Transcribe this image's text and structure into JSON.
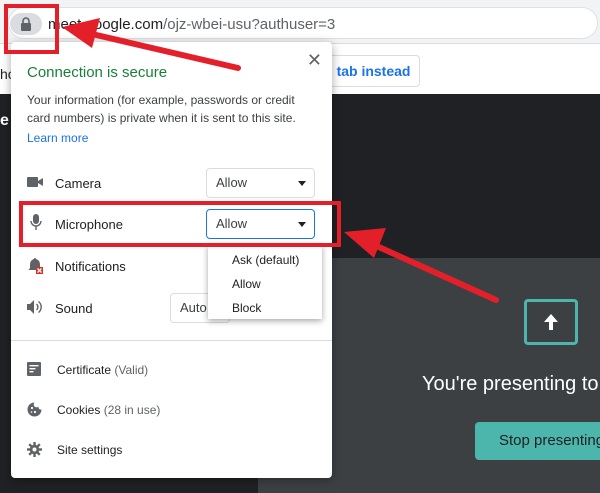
{
  "browser": {
    "url_host": "meet.google.com",
    "url_path": "/ojz-wbei-usu?authuser=3",
    "lock_icon": "lock-icon"
  },
  "page": {
    "left_edge_text": "ho",
    "left_dark_text": "e",
    "tab_button_label": "is tab instead",
    "present_icon": "present-screen-icon",
    "presenting_text": "You're presenting to",
    "stop_button_label": "Stop presenting"
  },
  "popup": {
    "close_label": "✕",
    "title": "Connection is secure",
    "description": "Your information (for example, passwords or credit card numbers) is private when it is sent to this site.",
    "learn_more": "Learn more",
    "permissions": [
      {
        "label": "Camera",
        "value": "Allow",
        "icon": "camera-icon"
      },
      {
        "label": "Microphone",
        "value": "Allow",
        "icon": "microphone-icon"
      },
      {
        "label": "Notifications",
        "value": "",
        "icon": "notifications-icon"
      },
      {
        "label": "Sound",
        "value": "Auto",
        "icon": "sound-icon"
      }
    ],
    "dropdown_options": [
      "Ask (default)",
      "Allow",
      "Block"
    ],
    "footer": [
      {
        "label": "Certificate",
        "paren": "(Valid)",
        "icon": "certificate-icon"
      },
      {
        "label": "Cookies",
        "paren": "(28 in use)",
        "icon": "cookies-icon"
      },
      {
        "label": "Site settings",
        "paren": "",
        "icon": "settings-gear-icon"
      }
    ]
  },
  "colors": {
    "annotation_red": "#e3202a",
    "secure_green": "#188038",
    "link_blue": "#1a73e8",
    "meet_teal": "#4db6ac"
  }
}
